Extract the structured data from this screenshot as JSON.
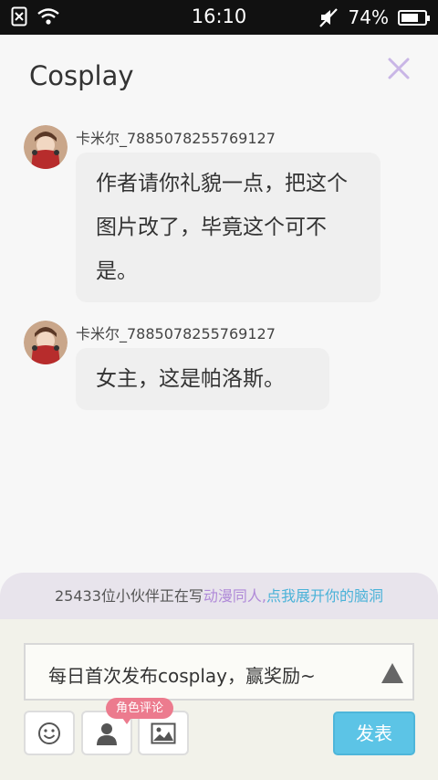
{
  "status_bar": {
    "time": "16:10",
    "battery_text": "74%",
    "battery_level": 0.74
  },
  "header": {
    "title": "Cosplay"
  },
  "messages": [
    {
      "username": "卡米尔_7885078255769127",
      "text": "作者请你礼貌一点，把这个图片改了，毕竟这个可不是。"
    },
    {
      "username": "卡米尔_7885078255769127",
      "text": "女主，这是帕洛斯。"
    }
  ],
  "banner": {
    "prefix": "25433位小伙伴正在写",
    "highlight1": "动漫同人,",
    "highlight2": "点我展开你的脑洞"
  },
  "composer": {
    "input_text": "每日首次发布cosplay，赢奖励~",
    "role_tag": "角色评论",
    "send_label": "发表",
    "icons": [
      "emoji-icon",
      "user-icon",
      "image-icon",
      "expand-up-icon",
      "close-icon"
    ]
  },
  "colors": {
    "accent_blue": "#5cc4e6",
    "accent_purple": "#b08ad8",
    "tag_pink": "#ec7b8e",
    "close_purple": "#c9b6e6"
  }
}
